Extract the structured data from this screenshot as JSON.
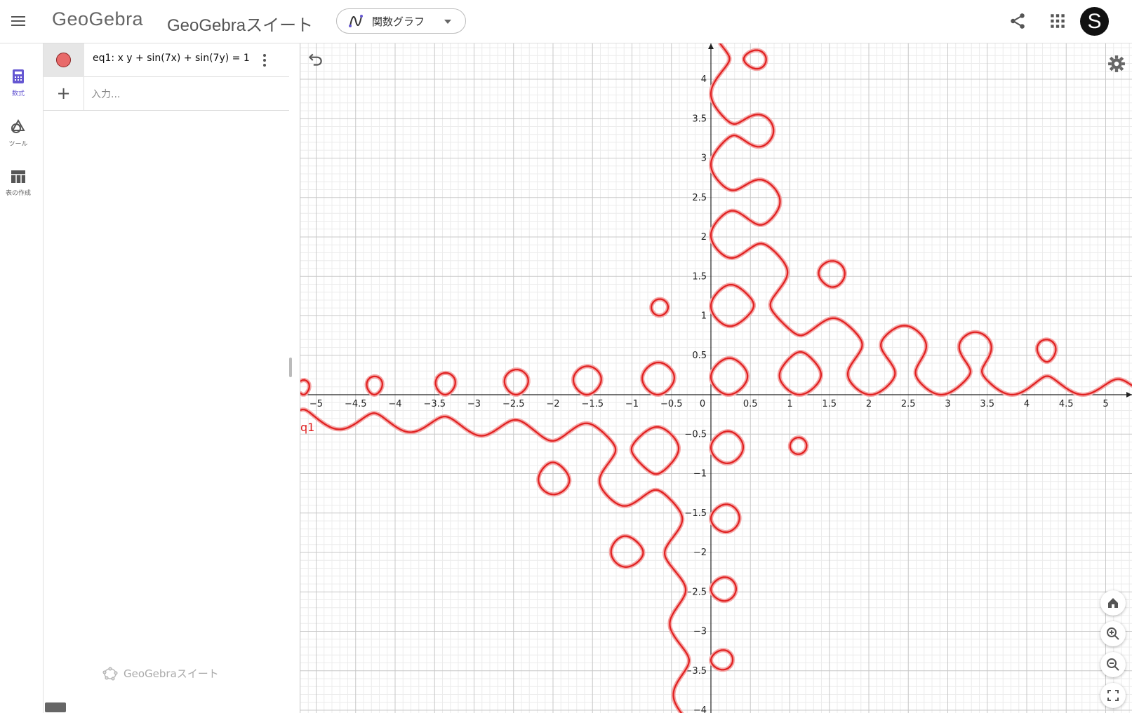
{
  "topbar": {
    "logo": "GeoGebra",
    "suite_title": "GeoGebraスイート",
    "app_selector": "関数グラフ",
    "avatar_letter": "S"
  },
  "siderail": {
    "items": [
      {
        "label": "数式",
        "icon": "calculator-icon",
        "active": true
      },
      {
        "label": "ツール",
        "icon": "shapes-icon",
        "active": false
      },
      {
        "label": "表の作成",
        "icon": "table-icon",
        "active": false
      }
    ]
  },
  "algebra": {
    "rows": [
      {
        "definition": "eq1: x y + sin(7x) + sin(7y) = 1",
        "color": "#e86a6a"
      }
    ],
    "input_placeholder": "入力...",
    "footer_brand": "GeoGebraスイート"
  },
  "graphics": {
    "object_label": "q1",
    "curve_color": "#e02020",
    "x_ticks": [
      "-5",
      "-4.5",
      "-4",
      "-3.5",
      "-3",
      "-2.5",
      "-2",
      "-1.5",
      "-1",
      "-0.5",
      "0",
      "0.5",
      "1",
      "1.5",
      "2",
      "2.5",
      "3",
      "3.5",
      "4",
      "4.5",
      "5"
    ],
    "y_ticks": [
      "4",
      "3.5",
      "3",
      "2.5",
      "2",
      "1.5",
      "1",
      "0.5",
      "-0.5",
      "-1",
      "-1.5",
      "-2",
      "-2.5",
      "-3",
      "-3.5",
      "-4"
    ],
    "view": {
      "xmin": -5.2,
      "xmax": 5.2,
      "ymin": -4.05,
      "ymax": 4.4
    },
    "equation": "x*y + sin(7x) + sin(7y) = 1"
  }
}
